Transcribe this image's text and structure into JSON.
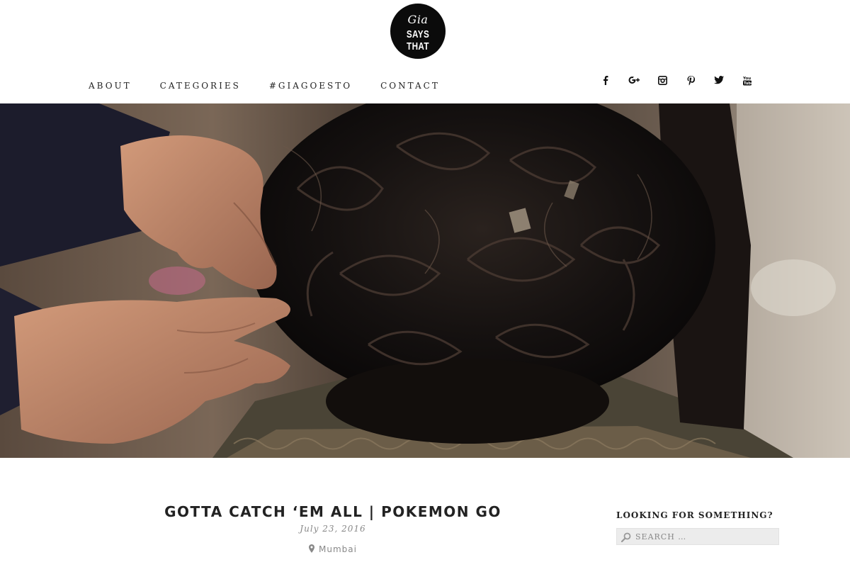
{
  "logo": {
    "script_text": "Gia",
    "block_text": "SAYS THAT"
  },
  "nav": [
    {
      "label": "ABOUT"
    },
    {
      "label": "CATEGORIES"
    },
    {
      "label": "#GIAGOESTO"
    },
    {
      "label": "CONTACT"
    }
  ],
  "social": [
    {
      "icon": "facebook-icon"
    },
    {
      "icon": "google-plus-icon"
    },
    {
      "icon": "instagram-icon"
    },
    {
      "icon": "pinterest-icon"
    },
    {
      "icon": "twitter-icon"
    },
    {
      "icon": "youtube-icon"
    }
  ],
  "hero": {
    "image": "hairstylist pinning curled dark hair updo"
  },
  "post": {
    "title": "GOTTA CATCH ‘EM ALL | POKEMON GO",
    "date": "July 23, 2016",
    "location": "Mumbai"
  },
  "sidebar": {
    "widget_title": "LOOKING FOR SOMETHING?",
    "search_placeholder": "SEARCH …"
  }
}
